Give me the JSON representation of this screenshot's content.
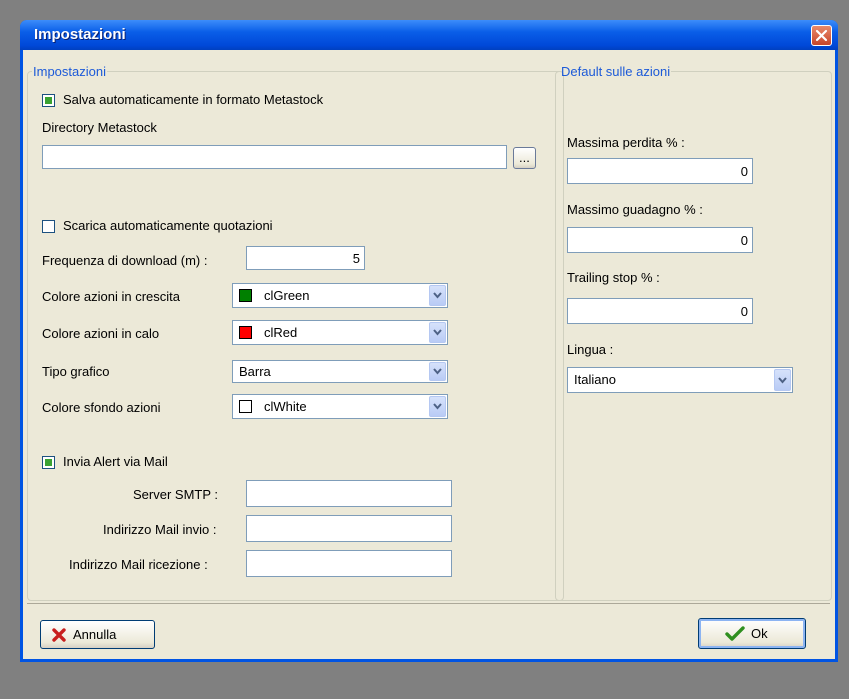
{
  "window": {
    "title": "Impostazioni"
  },
  "left_group": {
    "legend": "Impostazioni",
    "save_metastock": {
      "label": "Salva automaticamente in formato Metastock",
      "checked": true
    },
    "directory_label": "Directory Metastock",
    "directory_value": "",
    "browse_label": "...",
    "download_quotes": {
      "label": "Scarica automaticamente quotazioni",
      "checked": false
    },
    "frequency_label": "Frequenza di download (m) :",
    "frequency_value": "5",
    "up_color": {
      "label": "Colore azioni in crescita",
      "value": "clGreen",
      "swatch": "#008000"
    },
    "down_color": {
      "label": "Colore azioni in calo",
      "value": "clRed",
      "swatch": "#ff0000"
    },
    "chart_type": {
      "label": "Tipo grafico",
      "value": "Barra"
    },
    "bg_color": {
      "label": "Colore sfondo azioni",
      "value": "clWhite",
      "swatch": "#ffffff"
    },
    "mail_alert": {
      "label": "Invia Alert via Mail",
      "checked": true
    },
    "smtp_label": "Server SMTP :",
    "smtp_value": "",
    "mail_send_label": "Indirizzo Mail invio :",
    "mail_send_value": "",
    "mail_recv_label": "Indirizzo Mail ricezione :",
    "mail_recv_value": ""
  },
  "right_group": {
    "legend": "Default sulle azioni",
    "max_loss_label": "Massima perdita % :",
    "max_loss_value": "0",
    "max_gain_label": "Massimo guadagno % :",
    "max_gain_value": "0",
    "trailing_label": "Trailing stop % :",
    "trailing_value": "0",
    "language_label": "Lingua :",
    "language_value": "Italiano"
  },
  "footer": {
    "cancel_label": "Annulla",
    "ok_label": "Ok"
  },
  "colors": {
    "accent": "#1c5ad8",
    "title_bar": "#0054e3",
    "check_mark": "#3aa232"
  }
}
